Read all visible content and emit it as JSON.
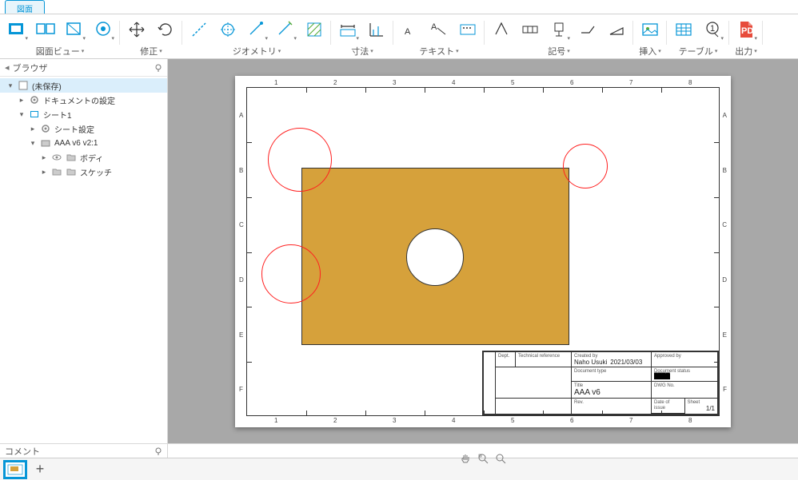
{
  "app": {
    "active_tab": "図面"
  },
  "toolbar": {
    "groups": {
      "view": {
        "label": "図面ビュー"
      },
      "modify": {
        "label": "修正"
      },
      "geom": {
        "label": "ジオメトリ"
      },
      "dim": {
        "label": "寸法"
      },
      "text": {
        "label": "テキスト"
      },
      "symbol": {
        "label": "記号"
      },
      "insert": {
        "label": "挿入"
      },
      "table": {
        "label": "テーブル"
      },
      "output": {
        "label": "出力"
      }
    }
  },
  "browser": {
    "title": "ブラウザ",
    "items": [
      {
        "depth": 0,
        "exp": "▾",
        "icon": "doc",
        "label": "(未保存)",
        "sel": true
      },
      {
        "depth": 1,
        "exp": "▸",
        "icon": "gear",
        "label": "ドキュメントの設定",
        "sel": false
      },
      {
        "depth": 1,
        "exp": "▾",
        "icon": "sheet",
        "label": "シート1",
        "sel": false
      },
      {
        "depth": 2,
        "exp": "▸",
        "icon": "gear",
        "label": "シート設定",
        "sel": false
      },
      {
        "depth": 2,
        "exp": "▾",
        "icon": "comp",
        "label": "AAA v6 v2:1",
        "sel": false
      },
      {
        "depth": 3,
        "exp": "▸",
        "icon": "eye",
        "label": "ボディ",
        "sel": false
      },
      {
        "depth": 3,
        "exp": "▸",
        "icon": "folder",
        "label": "スケッチ",
        "sel": false
      }
    ]
  },
  "sheet": {
    "col_letters": [
      "A",
      "B",
      "C",
      "D",
      "E",
      "F"
    ],
    "row_numbers": [
      "1",
      "2",
      "3",
      "4",
      "5",
      "6",
      "7",
      "8"
    ],
    "titleblock": {
      "dept_lab": "Dept.",
      "tech_ref_lab": "Technical reference",
      "created_lab": "Created by",
      "approved_lab": "Approved by",
      "created_by": "Naho Usuki",
      "created_date": "2021/03/03",
      "doctype_lab": "Document type",
      "docstatus_lab": "Document status",
      "title_lab": "Title",
      "dwgno_lab": "DWG No.",
      "title": "AAA v6",
      "rev_lab": "Rev.",
      "issue_lab": "Date of issue",
      "sheet_lab": "Sheet",
      "sheet_val": "1/1"
    }
  },
  "comment": {
    "label": "コメント"
  },
  "colors": {
    "accent": "#0696d7",
    "part": "#d6a13b",
    "anno": "#ff2020"
  }
}
